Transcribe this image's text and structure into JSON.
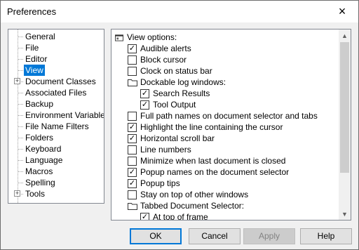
{
  "window": {
    "title": "Preferences"
  },
  "tree": {
    "items": [
      {
        "label": "General",
        "expand": false,
        "selected": false
      },
      {
        "label": "File",
        "expand": false,
        "selected": false
      },
      {
        "label": "Editor",
        "expand": false,
        "selected": false
      },
      {
        "label": "View",
        "expand": false,
        "selected": true
      },
      {
        "label": "Document Classes",
        "expand": true,
        "selected": false
      },
      {
        "label": "Associated Files",
        "expand": false,
        "selected": false
      },
      {
        "label": "Backup",
        "expand": false,
        "selected": false
      },
      {
        "label": "Environment Variables",
        "expand": false,
        "selected": false
      },
      {
        "label": "File Name Filters",
        "expand": false,
        "selected": false
      },
      {
        "label": "Folders",
        "expand": false,
        "selected": false
      },
      {
        "label": "Keyboard",
        "expand": false,
        "selected": false
      },
      {
        "label": "Language",
        "expand": false,
        "selected": false
      },
      {
        "label": "Macros",
        "expand": false,
        "selected": false
      },
      {
        "label": "Spelling",
        "expand": false,
        "selected": false
      },
      {
        "label": "Tools",
        "expand": true,
        "selected": false
      }
    ]
  },
  "options": {
    "header": "View options:",
    "items": [
      {
        "label": "Audible alerts",
        "kind": "check",
        "checked": true,
        "level": 1
      },
      {
        "label": "Block cursor",
        "kind": "check",
        "checked": false,
        "level": 1
      },
      {
        "label": "Clock on status bar",
        "kind": "check",
        "checked": false,
        "level": 1
      },
      {
        "label": "Dockable log windows:",
        "kind": "folder",
        "level": 1
      },
      {
        "label": "Search Results",
        "kind": "check",
        "checked": true,
        "level": 2
      },
      {
        "label": "Tool Output",
        "kind": "check",
        "checked": true,
        "level": 2
      },
      {
        "label": "Full path names on document selector and tabs",
        "kind": "check",
        "checked": false,
        "level": 1
      },
      {
        "label": "Highlight the line containing the cursor",
        "kind": "check",
        "checked": true,
        "level": 1
      },
      {
        "label": "Horizontal scroll bar",
        "kind": "check",
        "checked": true,
        "level": 1
      },
      {
        "label": "Line numbers",
        "kind": "check",
        "checked": false,
        "level": 1
      },
      {
        "label": "Minimize when last document is closed",
        "kind": "check",
        "checked": false,
        "level": 1
      },
      {
        "label": "Popup names on the document selector",
        "kind": "check",
        "checked": true,
        "level": 1
      },
      {
        "label": "Popup tips",
        "kind": "check",
        "checked": true,
        "level": 1
      },
      {
        "label": "Stay on top of other windows",
        "kind": "check",
        "checked": false,
        "level": 1
      },
      {
        "label": "Tabbed Document Selector:",
        "kind": "folder",
        "level": 1
      },
      {
        "label": "At top of frame",
        "kind": "check",
        "checked": true,
        "level": 2
      }
    ]
  },
  "buttons": {
    "ok": "OK",
    "cancel": "Cancel",
    "apply": "Apply",
    "help": "Help"
  },
  "icons": {
    "close": "×",
    "check": "✓",
    "plus": "+",
    "scroll_up": "▲",
    "scroll_down": "▼"
  }
}
